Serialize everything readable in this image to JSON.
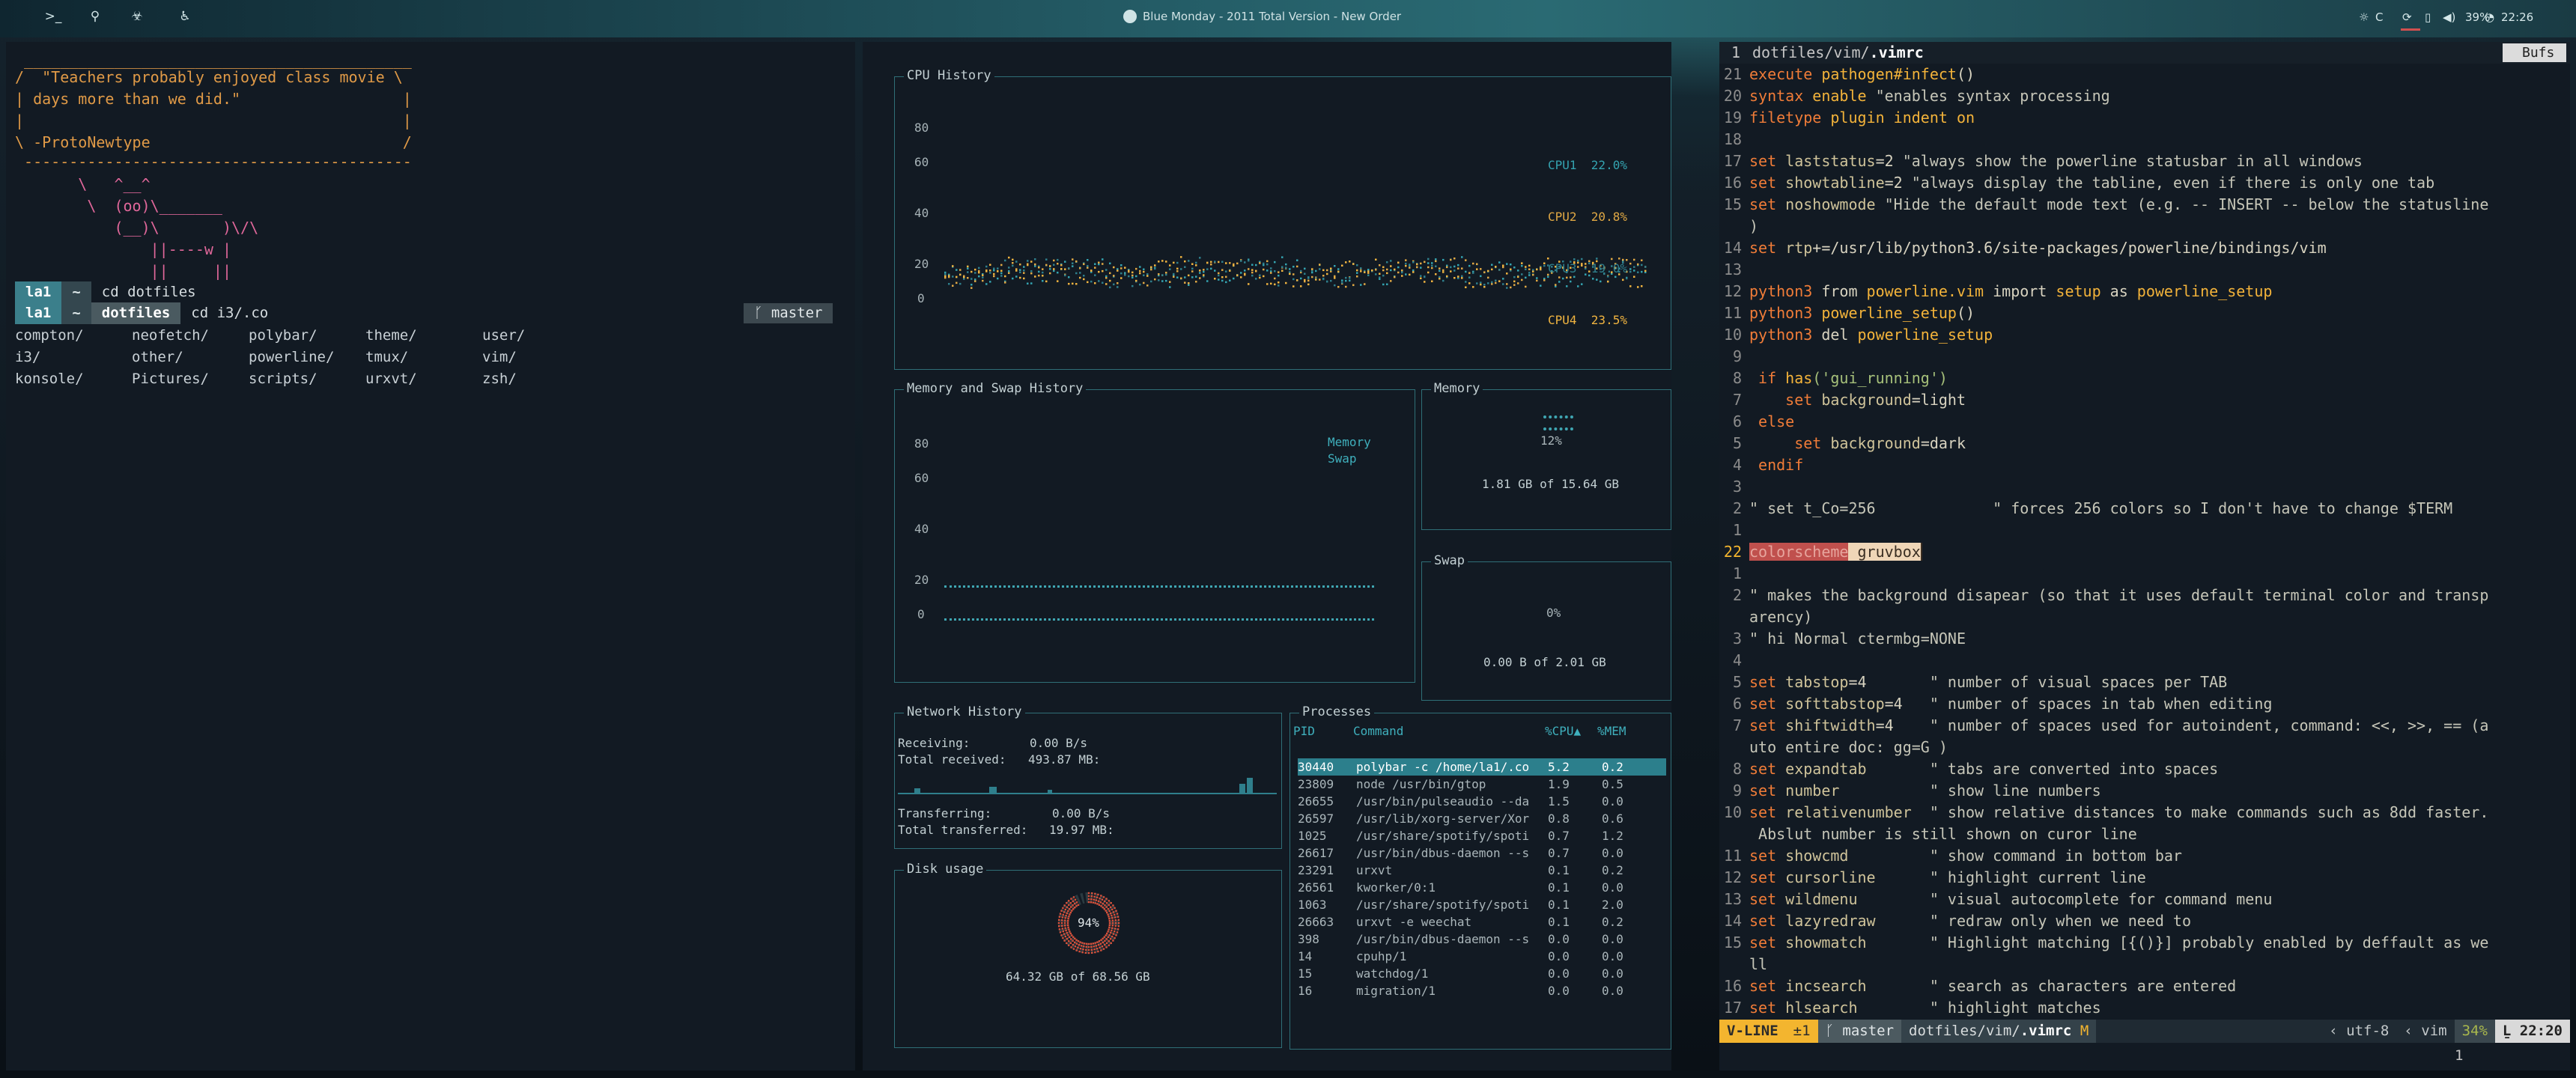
{
  "bar": {
    "workspaces": [
      {
        "icon": "terminal-icon",
        "glyph": ">_"
      },
      {
        "icon": "pin-icon",
        "glyph": "⚲"
      },
      {
        "icon": "biohazard-icon",
        "glyph": "☣"
      },
      {
        "icon": "accessibility-icon",
        "glyph": "♿"
      }
    ],
    "now_playing": "Blue Monday - 2011 Total Version - New Order",
    "brightness": "C",
    "volume": "39%",
    "clock": "22:26"
  },
  "terminal": {
    "cow_lines": [
      " ___________________________________________",
      "/  \"Teachers probably enjoyed class movie \\",
      "| days more than we did.\"                  |",
      "|                                          |",
      "\\ -ProtoNewtype                            /",
      " -------------------------------------------"
    ],
    "ascii_lines": [
      "       \\   ^__^",
      "        \\  (oo)\\_______",
      "           (__)\\       )\\/\\",
      "               ||----w |",
      "               ||     ||"
    ],
    "prompt1": {
      "user": "la1",
      "dir": "~",
      "cmd": "cd dotfiles"
    },
    "prompt2": {
      "user": "la1",
      "dir": "~",
      "subdir": "dotfiles",
      "cmd": "cd i3/.co",
      "branch": "master"
    },
    "ls_items": [
      "compton/",
      "neofetch/",
      "polybar/",
      "theme/",
      "user/",
      "i3/",
      "other/",
      "powerline/",
      "tmux/",
      "vim/",
      "konsole/",
      "Pictures/",
      "scripts/",
      "urxvt/",
      "zsh/"
    ]
  },
  "gtop": {
    "cpu_title": "CPU History",
    "cpu_yticks": [
      "80",
      "60",
      "40",
      "20",
      "0"
    ],
    "cpu_legend": [
      {
        "name": "CPU1",
        "value": "22.0%",
        "color": "#34a3b0"
      },
      {
        "name": "CPU2",
        "value": "20.8%",
        "color": "#e0a844"
      },
      {
        "name": "CPU3",
        "value": "19.0%",
        "color": "#2f7f8c"
      },
      {
        "name": "CPU4",
        "value": "23.5%",
        "color": "#f0b440"
      }
    ],
    "mem_title": "Memory and Swap History",
    "mem_yticks": [
      "80",
      "60",
      "40",
      "20",
      "0"
    ],
    "mem_legend": [
      "Memory",
      "Swap"
    ],
    "memory_title": "Memory",
    "memory_pct": "12%",
    "memory_fraction": 0.12,
    "memory_text": "1.81 GB of 15.64 GB",
    "swap_title": "Swap",
    "swap_pct": "0%",
    "swap_text": "0.00 B of 2.01 GB",
    "net_title": "Network History",
    "receiving_label": "Receiving:",
    "receiving": "0.00 B/s",
    "total_received_label": "Total received:",
    "total_received": "493.87 MB:",
    "transferring_label": "Transferring:",
    "transferring": "0.00 B/s",
    "total_transferred_label": "Total transferred:",
    "total_transferred": "19.97 MB:",
    "disk_title": "Disk usage",
    "disk_pct": "94%",
    "disk_fraction": 0.94,
    "disk_text": "64.32 GB of 68.56 GB",
    "proc_title": "Processes",
    "proc_headers": [
      "PID",
      "Command",
      "%CPU▲",
      "%MEM"
    ],
    "processes": [
      [
        "30440",
        "polybar -c /home/la1/.co",
        "5.2",
        "0.2"
      ],
      [
        "23809",
        "node /usr/bin/gtop",
        "1.9",
        "0.5"
      ],
      [
        "26655",
        "/usr/bin/pulseaudio --da",
        "1.5",
        "0.0"
      ],
      [
        "26597",
        "/usr/lib/xorg-server/Xor",
        "0.8",
        "0.6"
      ],
      [
        "1025",
        "/usr/share/spotify/spoti",
        "0.7",
        "1.2"
      ],
      [
        "26617",
        "/usr/bin/dbus-daemon --s",
        "0.7",
        "0.0"
      ],
      [
        "23291",
        "urxvt",
        "0.1",
        "0.2"
      ],
      [
        "26561",
        "kworker/0:1",
        "0.1",
        "0.0"
      ],
      [
        "1063",
        "/usr/share/spotify/spoti",
        "0.1",
        "2.0"
      ],
      [
        "26663",
        "urxvt -e weechat",
        "0.1",
        "0.2"
      ],
      [
        "398",
        "/usr/bin/dbus-daemon --s",
        "0.0",
        "0.0"
      ],
      [
        "14",
        "cpuhp/1",
        "0.0",
        "0.0"
      ],
      [
        "15",
        "watchdog/1",
        "0.0",
        "0.0"
      ],
      [
        "16",
        "migration/1",
        "0.0",
        "0.0"
      ]
    ]
  },
  "vim": {
    "tab_number": "1",
    "tab_path": "dotfiles/vim/",
    "tab_file": ".vimrc",
    "bufs_label": "Bufs",
    "lines": [
      {
        "n": "21",
        "t": [
          [
            "kw",
            "execute "
          ],
          [
            "fn",
            "pathogen#infect"
          ],
          [
            "tx",
            "()"
          ]
        ]
      },
      {
        "n": "20",
        "t": [
          [
            "kw",
            "syntax "
          ],
          [
            "k2",
            "enable "
          ],
          [
            "cm",
            "\"enables syntax processing"
          ]
        ]
      },
      {
        "n": "19",
        "t": [
          [
            "kw",
            "filetype "
          ],
          [
            "k2",
            "plugin indent on"
          ]
        ]
      },
      {
        "n": "18",
        "t": []
      },
      {
        "n": "17",
        "t": [
          [
            "kw",
            "set "
          ],
          [
            "sub",
            "laststatus"
          ],
          [
            "tx",
            "=2 "
          ],
          [
            "cm",
            "\"always show the powerline statusbar in all windows"
          ]
        ]
      },
      {
        "n": "16",
        "t": [
          [
            "kw",
            "set "
          ],
          [
            "sub",
            "showtabline"
          ],
          [
            "tx",
            "=2 "
          ],
          [
            "cm",
            "\"always display the tabline, even if there is only one tab"
          ]
        ]
      },
      {
        "n": "15",
        "t": [
          [
            "kw",
            "set "
          ],
          [
            "sub",
            "noshowmode "
          ],
          [
            "cm",
            "\"Hide the default mode text (e.g. -- INSERT -- below the statusline"
          ]
        ]
      },
      {
        "n": "",
        "t": [
          [
            "cm",
            ")"
          ]
        ]
      },
      {
        "n": "14",
        "t": [
          [
            "kw",
            "set "
          ],
          [
            "sub",
            "rtp"
          ],
          [
            "tx",
            "+=/usr/lib/python3.6/site-packages/powerline/bindings/vim"
          ]
        ]
      },
      {
        "n": "13",
        "t": []
      },
      {
        "n": "12",
        "t": [
          [
            "kw",
            "python3 "
          ],
          [
            "tx",
            "from "
          ],
          [
            "fn",
            "powerline.vim "
          ],
          [
            "tx",
            "import "
          ],
          [
            "fn",
            "setup "
          ],
          [
            "tx",
            "as "
          ],
          [
            "fn",
            "powerline_setup"
          ]
        ]
      },
      {
        "n": "11",
        "t": [
          [
            "kw",
            "python3 "
          ],
          [
            "fn",
            "powerline_setup"
          ],
          [
            "tx",
            "()"
          ]
        ]
      },
      {
        "n": "10",
        "t": [
          [
            "kw",
            "python3 "
          ],
          [
            "tx",
            "del "
          ],
          [
            "fn",
            "powerline_setup"
          ]
        ]
      },
      {
        "n": "9",
        "t": []
      },
      {
        "n": "8",
        "t": [
          [
            "tx",
            " "
          ],
          [
            "kw",
            "if "
          ],
          [
            "fn",
            "has"
          ],
          [
            "str",
            "('gui_running')"
          ]
        ]
      },
      {
        "n": "7",
        "t": [
          [
            "tx",
            "    "
          ],
          [
            "kw",
            "set "
          ],
          [
            "sub",
            "background"
          ],
          [
            "tx",
            "=light"
          ]
        ]
      },
      {
        "n": "6",
        "t": [
          [
            "tx",
            " "
          ],
          [
            "kw",
            "else"
          ]
        ]
      },
      {
        "n": "5",
        "t": [
          [
            "tx",
            "     "
          ],
          [
            "kw",
            "set "
          ],
          [
            "sub",
            "background"
          ],
          [
            "tx",
            "=dark"
          ]
        ]
      },
      {
        "n": "4",
        "t": [
          [
            "tx",
            " "
          ],
          [
            "kw",
            "endif"
          ]
        ]
      },
      {
        "n": "3",
        "t": []
      },
      {
        "n": "2",
        "t": [
          [
            "cm",
            "\" set t_Co=256             \" forces 256 colors so I don't have to change $TERM"
          ]
        ]
      },
      {
        "n": "1",
        "t": []
      },
      {
        "n": "22",
        "cur": true,
        "t": [
          [
            "hl1",
            "colorscheme"
          ],
          [
            "hl2",
            " gruvbox"
          ]
        ]
      },
      {
        "n": "1",
        "t": []
      },
      {
        "n": "2",
        "t": [
          [
            "cm",
            "\" makes the background disapear (so that it uses default terminal color and transp"
          ]
        ]
      },
      {
        "n": "",
        "t": [
          [
            "cm",
            "arency)"
          ]
        ]
      },
      {
        "n": "3",
        "t": [
          [
            "cm",
            "\" hi Normal ctermbg=NONE"
          ]
        ]
      },
      {
        "n": "4",
        "t": []
      },
      {
        "n": "5",
        "t": [
          [
            "kw",
            "set "
          ],
          [
            "sub",
            "tabstop"
          ],
          [
            "tx",
            "=4       "
          ],
          [
            "cm",
            "\" number of visual spaces per TAB"
          ]
        ]
      },
      {
        "n": "6",
        "t": [
          [
            "kw",
            "set "
          ],
          [
            "sub",
            "softtabstop"
          ],
          [
            "tx",
            "=4   "
          ],
          [
            "cm",
            "\" number of spaces in tab when editing"
          ]
        ]
      },
      {
        "n": "7",
        "t": [
          [
            "kw",
            "set "
          ],
          [
            "sub",
            "shiftwidth"
          ],
          [
            "tx",
            "=4    "
          ],
          [
            "cm",
            "\" number of spaces used for autoindent, command: <<, >>, == (a"
          ]
        ]
      },
      {
        "n": "",
        "t": [
          [
            "cm",
            "uto entire doc: gg=G )"
          ]
        ]
      },
      {
        "n": "8",
        "t": [
          [
            "kw",
            "set "
          ],
          [
            "sub",
            "expandtab       "
          ],
          [
            "cm",
            "\" tabs are converted into spaces"
          ]
        ]
      },
      {
        "n": "9",
        "t": [
          [
            "kw",
            "set "
          ],
          [
            "sub",
            "number          "
          ],
          [
            "cm",
            "\" show line numbers"
          ]
        ]
      },
      {
        "n": "10",
        "t": [
          [
            "kw",
            "set "
          ],
          [
            "sub",
            "relativenumber  "
          ],
          [
            "cm",
            "\" show relative distances to make commands such as 8dd faster."
          ]
        ]
      },
      {
        "n": "",
        "t": [
          [
            "cm",
            " Abslut number is still shown on curor line"
          ]
        ]
      },
      {
        "n": "11",
        "t": [
          [
            "kw",
            "set "
          ],
          [
            "sub",
            "showcmd         "
          ],
          [
            "cm",
            "\" show command in bottom bar"
          ]
        ]
      },
      {
        "n": "12",
        "t": [
          [
            "kw",
            "set "
          ],
          [
            "sub",
            "cursorline      "
          ],
          [
            "cm",
            "\" highlight current line"
          ]
        ]
      },
      {
        "n": "13",
        "t": [
          [
            "kw",
            "set "
          ],
          [
            "sub",
            "wildmenu        "
          ],
          [
            "cm",
            "\" visual autocomplete for command menu"
          ]
        ]
      },
      {
        "n": "14",
        "t": [
          [
            "kw",
            "set "
          ],
          [
            "sub",
            "lazyredraw      "
          ],
          [
            "cm",
            "\" redraw only when we need to"
          ]
        ]
      },
      {
        "n": "15",
        "t": [
          [
            "kw",
            "set "
          ],
          [
            "sub",
            "showmatch       "
          ],
          [
            "cm",
            "\" Highlight matching [{()}] probably enabled by deffault as we"
          ]
        ]
      },
      {
        "n": "",
        "t": [
          [
            "cm",
            "ll"
          ]
        ]
      },
      {
        "n": "16",
        "t": [
          [
            "kw",
            "set "
          ],
          [
            "sub",
            "incsearch       "
          ],
          [
            "cm",
            "\" search as characters are entered"
          ]
        ]
      },
      {
        "n": "17",
        "t": [
          [
            "kw",
            "set "
          ],
          [
            "sub",
            "hlsearch        "
          ],
          [
            "cm",
            "\" highlight matches"
          ]
        ]
      }
    ],
    "status": {
      "mode": "V-LINE",
      "sel": "±1",
      "branch": "master",
      "path": "dotfiles/vim/",
      "file": ".vimrc",
      "modified": "M",
      "encoding": "utf-8",
      "filetype": "vim",
      "percent": "34%",
      "position": "22:20"
    },
    "cmdline": "1"
  }
}
